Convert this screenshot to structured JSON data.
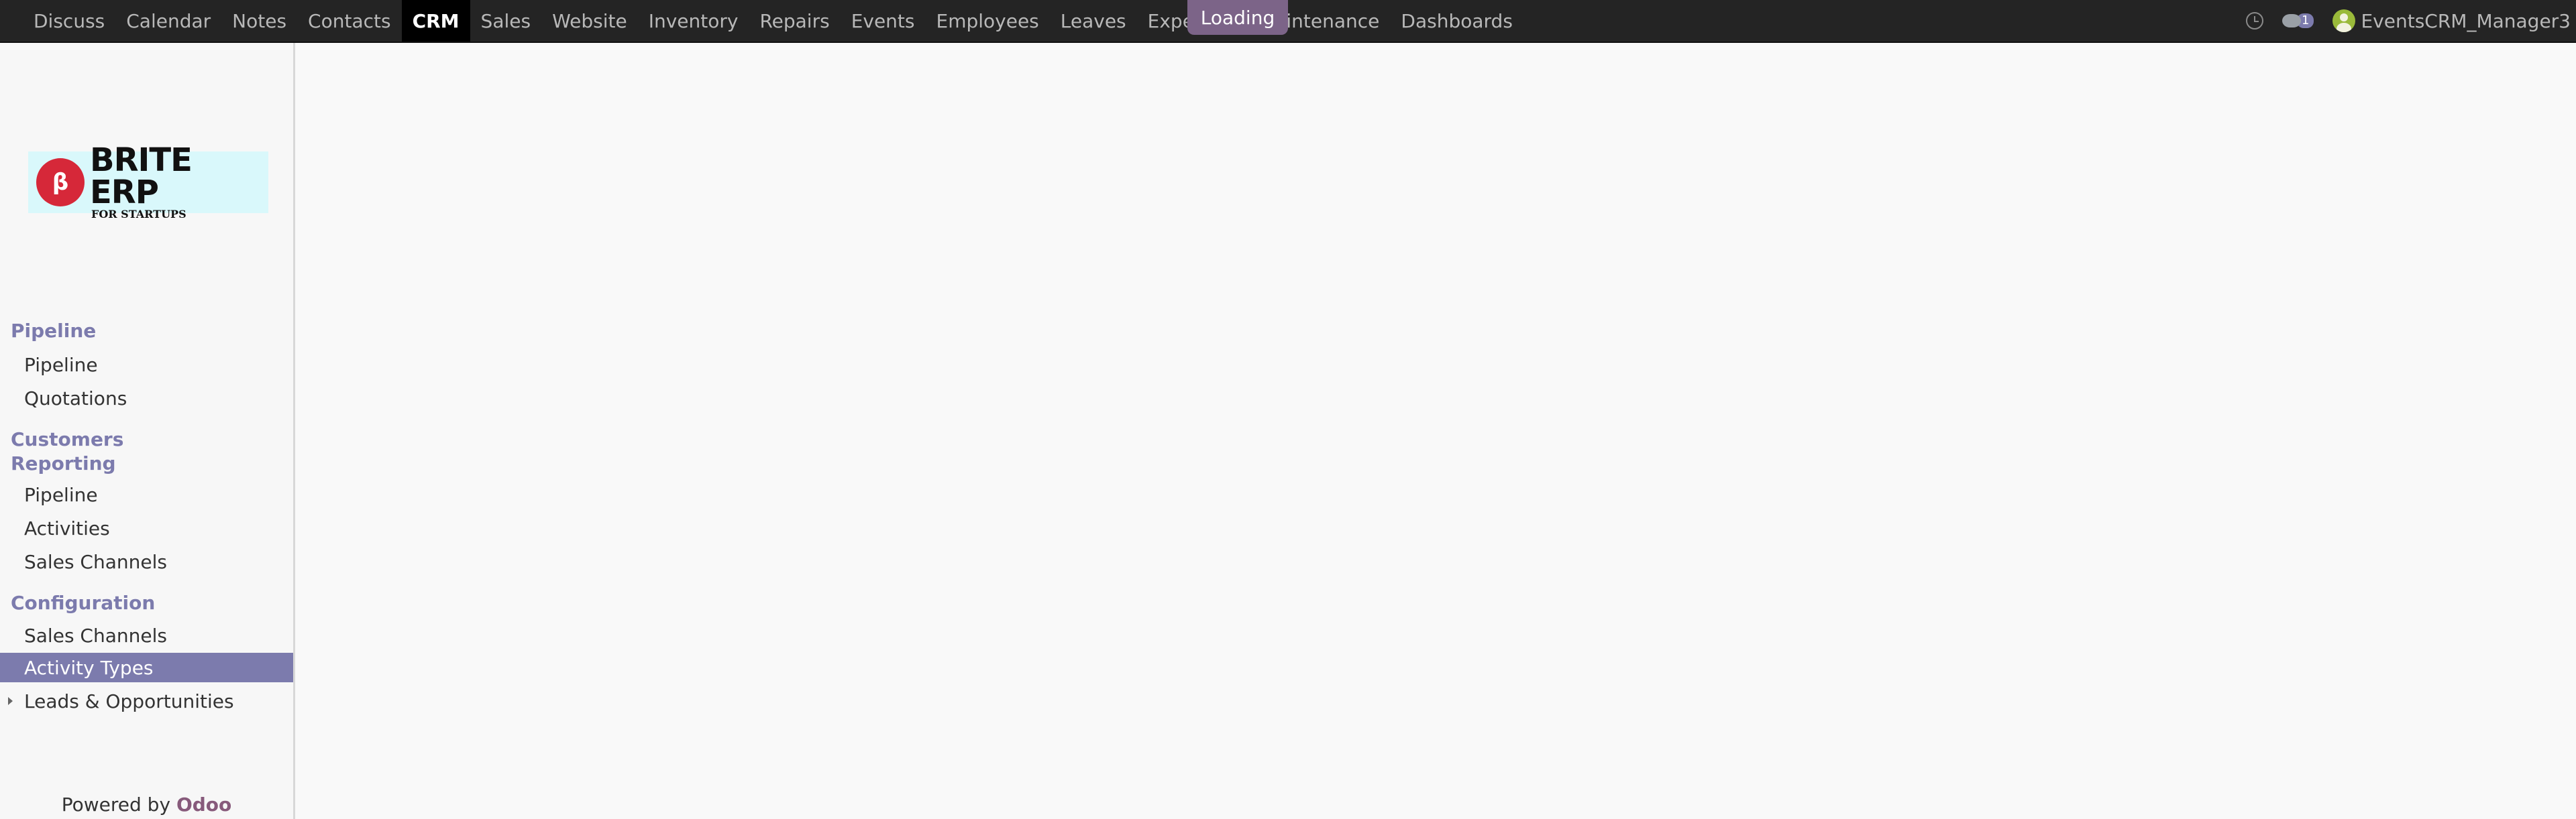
{
  "topbar": {
    "apps": [
      "Discuss",
      "Calendar",
      "Notes",
      "Contacts",
      "CRM",
      "Sales",
      "Website",
      "Inventory",
      "Repairs",
      "Events",
      "Employees",
      "Leaves",
      "Expenses",
      "Maintenance",
      "Dashboards"
    ],
    "active_app": "CRM",
    "loading_label": "Loading",
    "message_count": "1",
    "user_name": "EventsCRM_Manager3"
  },
  "logo": {
    "name": "BRITE ERP",
    "tagline": "FOR STARTUPS",
    "mark": "β"
  },
  "sidebar": {
    "sections": {
      "pipeline": "Pipeline",
      "customers": "Customers",
      "reporting": "Reporting",
      "configuration": "Configuration"
    },
    "items": {
      "pipeline": "Pipeline",
      "quotations": "Quotations",
      "report_pipeline": "Pipeline",
      "activities": "Activities",
      "report_sales_channels": "Sales Channels",
      "config_sales_channels": "Sales Channels",
      "activity_types": "Activity Types",
      "leads_opportunities": "Leads & Opportunities"
    },
    "powered_by": "Powered by",
    "powered_brand": "Odoo"
  },
  "colors": {
    "accent": "#7c7bad",
    "loading": "#7c6488",
    "navbar": "#242424",
    "odoo": "#875a7b"
  }
}
